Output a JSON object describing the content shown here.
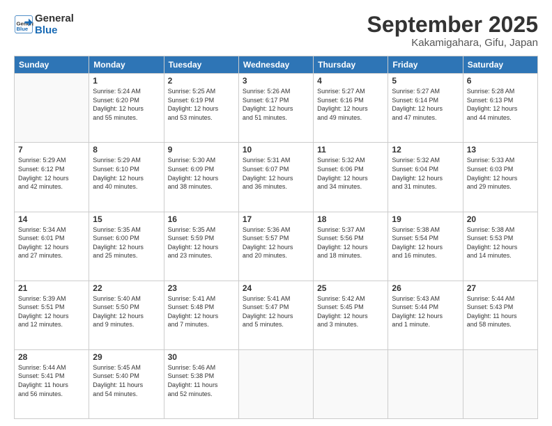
{
  "header": {
    "logo_line1": "General",
    "logo_line2": "Blue",
    "month": "September 2025",
    "location": "Kakamigahara, Gifu, Japan"
  },
  "weekdays": [
    "Sunday",
    "Monday",
    "Tuesday",
    "Wednesday",
    "Thursday",
    "Friday",
    "Saturday"
  ],
  "weeks": [
    [
      {
        "day": "",
        "info": ""
      },
      {
        "day": "1",
        "info": "Sunrise: 5:24 AM\nSunset: 6:20 PM\nDaylight: 12 hours\nand 55 minutes."
      },
      {
        "day": "2",
        "info": "Sunrise: 5:25 AM\nSunset: 6:19 PM\nDaylight: 12 hours\nand 53 minutes."
      },
      {
        "day": "3",
        "info": "Sunrise: 5:26 AM\nSunset: 6:17 PM\nDaylight: 12 hours\nand 51 minutes."
      },
      {
        "day": "4",
        "info": "Sunrise: 5:27 AM\nSunset: 6:16 PM\nDaylight: 12 hours\nand 49 minutes."
      },
      {
        "day": "5",
        "info": "Sunrise: 5:27 AM\nSunset: 6:14 PM\nDaylight: 12 hours\nand 47 minutes."
      },
      {
        "day": "6",
        "info": "Sunrise: 5:28 AM\nSunset: 6:13 PM\nDaylight: 12 hours\nand 44 minutes."
      }
    ],
    [
      {
        "day": "7",
        "info": "Sunrise: 5:29 AM\nSunset: 6:12 PM\nDaylight: 12 hours\nand 42 minutes."
      },
      {
        "day": "8",
        "info": "Sunrise: 5:29 AM\nSunset: 6:10 PM\nDaylight: 12 hours\nand 40 minutes."
      },
      {
        "day": "9",
        "info": "Sunrise: 5:30 AM\nSunset: 6:09 PM\nDaylight: 12 hours\nand 38 minutes."
      },
      {
        "day": "10",
        "info": "Sunrise: 5:31 AM\nSunset: 6:07 PM\nDaylight: 12 hours\nand 36 minutes."
      },
      {
        "day": "11",
        "info": "Sunrise: 5:32 AM\nSunset: 6:06 PM\nDaylight: 12 hours\nand 34 minutes."
      },
      {
        "day": "12",
        "info": "Sunrise: 5:32 AM\nSunset: 6:04 PM\nDaylight: 12 hours\nand 31 minutes."
      },
      {
        "day": "13",
        "info": "Sunrise: 5:33 AM\nSunset: 6:03 PM\nDaylight: 12 hours\nand 29 minutes."
      }
    ],
    [
      {
        "day": "14",
        "info": "Sunrise: 5:34 AM\nSunset: 6:01 PM\nDaylight: 12 hours\nand 27 minutes."
      },
      {
        "day": "15",
        "info": "Sunrise: 5:35 AM\nSunset: 6:00 PM\nDaylight: 12 hours\nand 25 minutes."
      },
      {
        "day": "16",
        "info": "Sunrise: 5:35 AM\nSunset: 5:59 PM\nDaylight: 12 hours\nand 23 minutes."
      },
      {
        "day": "17",
        "info": "Sunrise: 5:36 AM\nSunset: 5:57 PM\nDaylight: 12 hours\nand 20 minutes."
      },
      {
        "day": "18",
        "info": "Sunrise: 5:37 AM\nSunset: 5:56 PM\nDaylight: 12 hours\nand 18 minutes."
      },
      {
        "day": "19",
        "info": "Sunrise: 5:38 AM\nSunset: 5:54 PM\nDaylight: 12 hours\nand 16 minutes."
      },
      {
        "day": "20",
        "info": "Sunrise: 5:38 AM\nSunset: 5:53 PM\nDaylight: 12 hours\nand 14 minutes."
      }
    ],
    [
      {
        "day": "21",
        "info": "Sunrise: 5:39 AM\nSunset: 5:51 PM\nDaylight: 12 hours\nand 12 minutes."
      },
      {
        "day": "22",
        "info": "Sunrise: 5:40 AM\nSunset: 5:50 PM\nDaylight: 12 hours\nand 9 minutes."
      },
      {
        "day": "23",
        "info": "Sunrise: 5:41 AM\nSunset: 5:48 PM\nDaylight: 12 hours\nand 7 minutes."
      },
      {
        "day": "24",
        "info": "Sunrise: 5:41 AM\nSunset: 5:47 PM\nDaylight: 12 hours\nand 5 minutes."
      },
      {
        "day": "25",
        "info": "Sunrise: 5:42 AM\nSunset: 5:45 PM\nDaylight: 12 hours\nand 3 minutes."
      },
      {
        "day": "26",
        "info": "Sunrise: 5:43 AM\nSunset: 5:44 PM\nDaylight: 12 hours\nand 1 minute."
      },
      {
        "day": "27",
        "info": "Sunrise: 5:44 AM\nSunset: 5:43 PM\nDaylight: 11 hours\nand 58 minutes."
      }
    ],
    [
      {
        "day": "28",
        "info": "Sunrise: 5:44 AM\nSunset: 5:41 PM\nDaylight: 11 hours\nand 56 minutes."
      },
      {
        "day": "29",
        "info": "Sunrise: 5:45 AM\nSunset: 5:40 PM\nDaylight: 11 hours\nand 54 minutes."
      },
      {
        "day": "30",
        "info": "Sunrise: 5:46 AM\nSunset: 5:38 PM\nDaylight: 11 hours\nand 52 minutes."
      },
      {
        "day": "",
        "info": ""
      },
      {
        "day": "",
        "info": ""
      },
      {
        "day": "",
        "info": ""
      },
      {
        "day": "",
        "info": ""
      }
    ]
  ]
}
